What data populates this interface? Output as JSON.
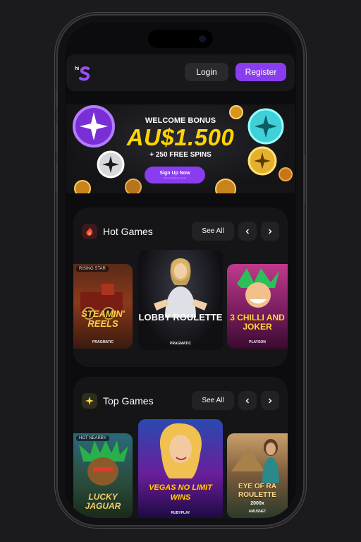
{
  "header": {
    "login_label": "Login",
    "register_label": "Register"
  },
  "hero": {
    "welcome": "WELCOME BONUS",
    "amount": "AU$1.500",
    "spins": "+ 250 FREE SPINS",
    "cta": "Sign Up Now",
    "cta_sub": "This only takes a minute"
  },
  "sections": [
    {
      "title": "Hot Games",
      "icon": "fire-icon",
      "see_all": "See All",
      "games": [
        {
          "badge": "RISING STAR",
          "name": "STEAMIN' REELS",
          "provider": "PRAGMATIC"
        },
        {
          "name": "LOBBY ROULETTE",
          "provider": "PRAGMATIC"
        },
        {
          "name": "3 CHILLI AND JOKER",
          "provider": "PLAYSON"
        }
      ]
    },
    {
      "title": "Top Games",
      "icon": "sparkle-icon",
      "see_all": "See All",
      "games": [
        {
          "badge": "HOT NEARBY",
          "name": "LUCKY JAGUAR",
          "provider": ""
        },
        {
          "name": "VEGAS NO LIMIT WINS",
          "provider": "RUBYPLAY"
        },
        {
          "name": "EYE OF RA ROULETTE",
          "provider": "AMUSNET",
          "sub": "2000x"
        }
      ]
    }
  ],
  "colors": {
    "accent": "#8a3cf0",
    "bonus_yellow": "#ffd400",
    "background": "#0c0c0e"
  }
}
